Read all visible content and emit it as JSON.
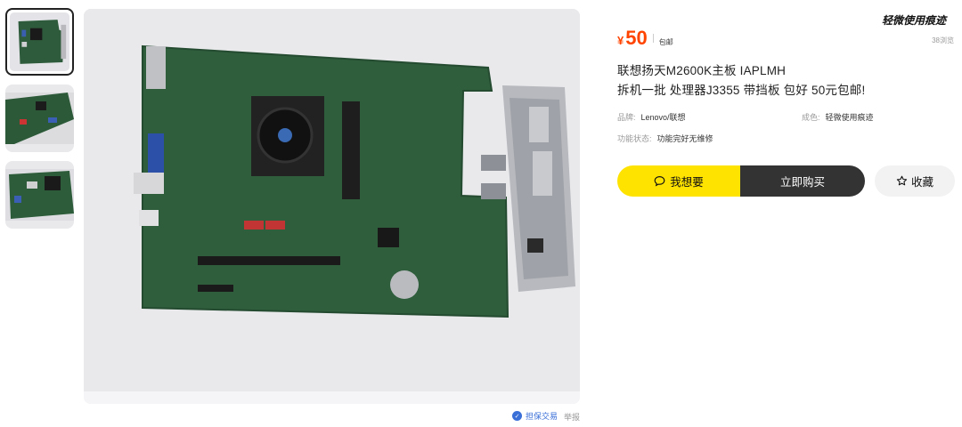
{
  "gallery": {
    "thumbnails": [
      {
        "icon": "motherboard-photo",
        "active": true
      },
      {
        "icon": "motherboard-angle-photo",
        "active": false
      },
      {
        "icon": "motherboard-cpu-photo",
        "active": false
      }
    ],
    "main_image": "lenovo-motherboard-with-io-shield-photo"
  },
  "footer": {
    "guarantee_label": "担保交易",
    "report_label": "举报"
  },
  "product": {
    "currency": "¥",
    "price": "50",
    "shipping": "包邮",
    "condition_badge": "轻微使用痕迹",
    "views": "38浏览",
    "title_line1": "联想扬天M2600K主板 IAPLMH",
    "title_line2": "拆机一批 处理器J3355 带挡板 包好 50元包邮!",
    "attributes": {
      "brand_key": "品牌:",
      "brand_value": "Lenovo/联想",
      "condition_key": "成色:",
      "condition_value": "轻微使用痕迹",
      "function_key": "功能状态:",
      "function_value": "功能完好无维修"
    }
  },
  "actions": {
    "want_label": "我想要",
    "buy_label": "立即购买",
    "favorite_label": "收藏"
  },
  "colors": {
    "price": "#ff4400",
    "accent_yellow": "#ffe300",
    "buy_dark": "#333333",
    "link_blue": "#3a6fd8"
  }
}
